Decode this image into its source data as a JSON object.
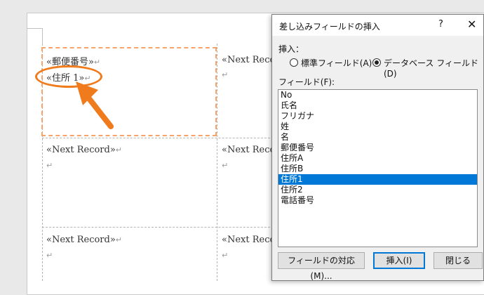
{
  "document": {
    "cell1": {
      "line1": "«郵便番号»",
      "line2": "«住所 1»"
    },
    "next_record": "«Next Record»",
    "paragraph_mark": "↵",
    "accent_color": "#f07b1c"
  },
  "dialog": {
    "title": "差し込みフィールドの挿入",
    "help": "?",
    "close": "✕",
    "insert_group_label": "挿入：",
    "radio_standard": {
      "label": "標準フィールド(A)",
      "checked": false
    },
    "radio_database": {
      "label": "データベース フィールド(D)",
      "checked": true
    },
    "field_label": "フィールド(F):",
    "fields": [
      "No",
      "氏名",
      "フリガナ",
      "姓",
      "名",
      "郵便番号",
      "住所A",
      "住所B",
      "住所1",
      "住所2",
      "電話番号"
    ],
    "selected_field": "住所1",
    "buttons": {
      "match_fields": "フィールドの対応(M)...",
      "insert": "挿入(I)",
      "close": "閉じる"
    },
    "selection_color": "#0078d7"
  }
}
